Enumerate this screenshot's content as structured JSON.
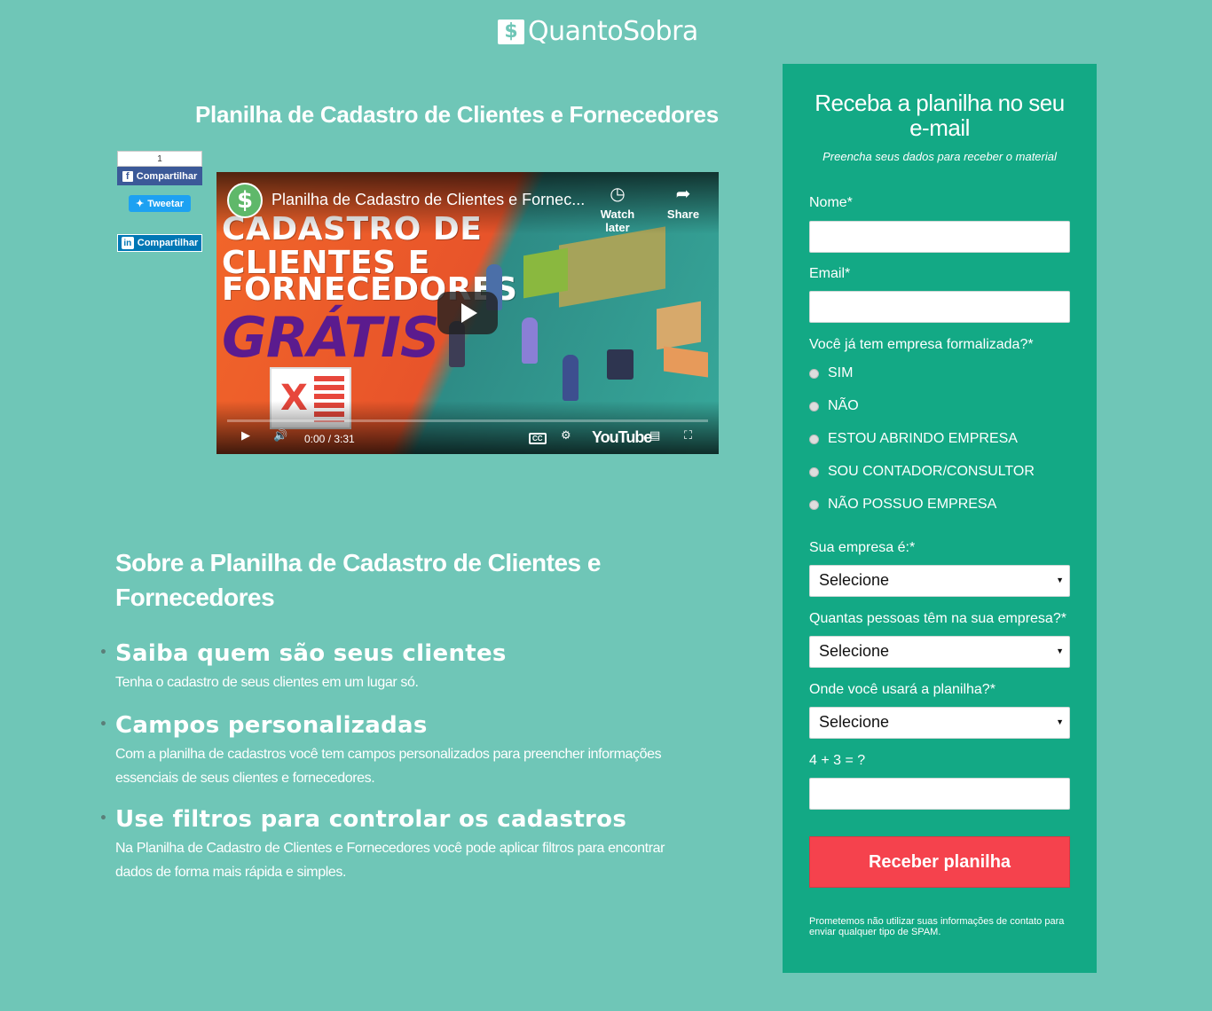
{
  "header": {
    "logo_mark": "$",
    "logo_text": "QuantoSobra"
  },
  "page_title": "Planilha de Cadastro de Clientes e Fornecedores",
  "social": {
    "facebook_count": "1",
    "facebook_label": "Compartilhar",
    "twitter_label": "Tweetar",
    "linkedin_label": "Compartilhar"
  },
  "video": {
    "channel_mark": "$",
    "title": "Planilha de Cadastro de Clientes e Fornec...",
    "watch_later": "Watch later",
    "share": "Share",
    "thumb_lines": [
      "CADASTRO DE",
      "CLIENTES E",
      "FORNECEDORES"
    ],
    "thumb_gratis": "GRÁTIS",
    "excel_mark": "X",
    "time": "0:00 / 3:31",
    "cc": "CC",
    "youtube": "YouTube",
    "progress": 0
  },
  "about": {
    "title": "Sobre a Planilha de Cadastro de Clientes e Fornecedores",
    "features": [
      {
        "heading": "Saiba quem são seus clientes",
        "text": "Tenha o cadastro de seus clientes em um lugar só."
      },
      {
        "heading": "Campos personalizadas",
        "text": "Com a planilha de cadastros você tem campos personalizados para preencher informações essenciais de seus clientes e fornecedores."
      },
      {
        "heading": "Use filtros para controlar os cadastros",
        "text": "Na Planilha de Cadastro de Clientes e Fornecedores você pode aplicar filtros para encontrar dados de forma mais rápida e simples."
      }
    ]
  },
  "form": {
    "title": "Receba a planilha no seu e-mail",
    "subtitle": "Preencha seus dados para receber o material",
    "name_label": "Nome*",
    "name_value": "",
    "email_label": "Email*",
    "email_value": "",
    "company_question": "Você já tem empresa formalizada?*",
    "company_options": [
      "SIM",
      "NÃO",
      "ESTOU ABRINDO EMPRESA",
      "SOU CONTADOR/CONSULTOR",
      "NÃO POSSUO EMPRESA"
    ],
    "type_label": "Sua empresa é:*",
    "type_value": "Selecione",
    "people_label": "Quantas pessoas têm na sua empresa?*",
    "people_value": "Selecione",
    "usage_label": "Onde você usará a planilha?*",
    "usage_value": "Selecione",
    "captcha_label": "4 + 3 = ?",
    "captcha_value": "",
    "submit_label": "Receber planilha",
    "disclaimer": "Prometemos não utilizar suas informações de contato para enviar qualquer tipo de SPAM."
  },
  "colors": {
    "background": "#6fc6b7",
    "panel": "#13a985",
    "submit": "#f5424d",
    "facebook": "#3b5998",
    "twitter": "#1da1f2",
    "linkedin": "#0077b5"
  }
}
